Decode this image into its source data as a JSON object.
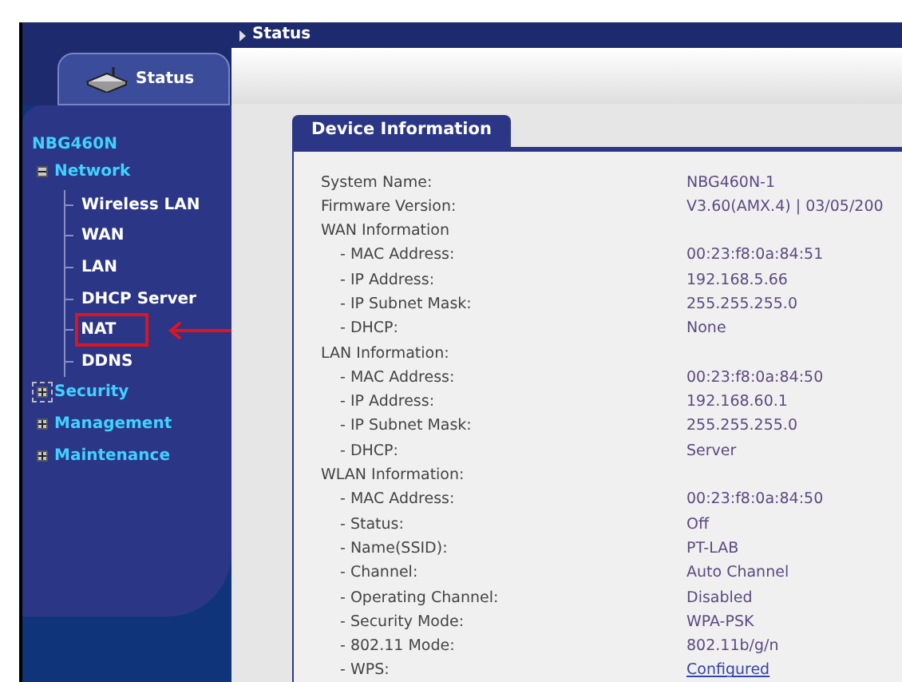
{
  "top_bar": {
    "title": "Status"
  },
  "sidebar": {
    "tab": {
      "label": "Status",
      "selected": true
    },
    "device": "NBG460N",
    "items": [
      {
        "label": "Network",
        "expanded": true,
        "children": [
          {
            "label": "Wireless LAN",
            "highlighted": false
          },
          {
            "label": "WAN",
            "highlighted": false
          },
          {
            "label": "LAN",
            "highlighted": false
          },
          {
            "label": "DHCP Server",
            "highlighted": false
          },
          {
            "label": "NAT",
            "highlighted": true
          },
          {
            "label": "DDNS",
            "highlighted": false
          }
        ]
      },
      {
        "label": "Security",
        "expanded": false,
        "focused": true
      },
      {
        "label": "Management",
        "expanded": false,
        "focused": false
      },
      {
        "label": "Maintenance",
        "expanded": false,
        "focused": false
      }
    ]
  },
  "panel": {
    "tab": "Device Information",
    "rows": [
      {
        "label": "System Name:",
        "value": "NBG460N-1",
        "indent": false
      },
      {
        "label": "Firmware Version:",
        "value": "V3.60(AMX.4) | 03/05/200",
        "indent": false
      },
      {
        "label": "WAN Information",
        "indent": false
      },
      {
        "label": "- MAC Address:",
        "value": "00:23:f8:0a:84:51",
        "indent": true
      },
      {
        "label": "- IP Address:",
        "value": "192.168.5.66",
        "indent": true
      },
      {
        "label": "- IP Subnet Mask:",
        "value": "255.255.255.0",
        "indent": true
      },
      {
        "label": "- DHCP:",
        "value": "None",
        "indent": true
      },
      {
        "label": "LAN Information:",
        "indent": false
      },
      {
        "label": "- MAC Address:",
        "value": "00:23:f8:0a:84:50",
        "indent": true
      },
      {
        "label": "- IP Address:",
        "value": "192.168.60.1",
        "indent": true
      },
      {
        "label": "- IP Subnet Mask:",
        "value": "255.255.255.0",
        "indent": true
      },
      {
        "label": "- DHCP:",
        "value": "Server",
        "indent": true
      },
      {
        "label": "WLAN Information:",
        "indent": false
      },
      {
        "label": "- MAC Address:",
        "value": "00:23:f8:0a:84:50",
        "indent": true
      },
      {
        "label": "- Status:",
        "value": "Off",
        "indent": true
      },
      {
        "label": "- Name(SSID):",
        "value": "PT-LAB",
        "indent": true
      },
      {
        "label": "- Channel:",
        "value": "Auto Channel",
        "indent": true
      },
      {
        "label": "- Operating Channel:",
        "value": "Disabled",
        "indent": true
      },
      {
        "label": "- Security Mode:",
        "value": "WPA-PSK",
        "indent": true
      },
      {
        "label": "- 802.11 Mode:",
        "value": "802.11b/g/n",
        "indent": true
      },
      {
        "label": "- WPS:",
        "value": "Configured",
        "indent": true,
        "link": true
      }
    ]
  }
}
